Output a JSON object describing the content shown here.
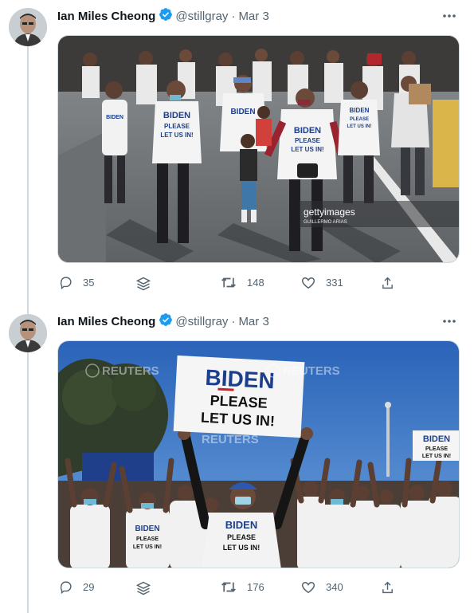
{
  "tweets": [
    {
      "name": "Ian Miles Cheong",
      "handle": "@stillgray",
      "separator": "·",
      "date": "Mar 3",
      "image_caption_credit": {
        "brand": "gettyimages",
        "photographer": "GUILLERMO ARIAS"
      },
      "image_sign_text": [
        "BIDEN",
        "PLEASE",
        "LET US IN!"
      ],
      "replies": "35",
      "retweets": "148",
      "likes": "331"
    },
    {
      "name": "Ian Miles Cheong",
      "handle": "@stillgray",
      "separator": "·",
      "date": "Mar 3",
      "watermark": "REUTERS",
      "image_sign_text": [
        "BIDEN",
        "PLEASE",
        "LET US IN!"
      ],
      "replies": "29",
      "retweets": "176",
      "likes": "340"
    }
  ],
  "icons": {
    "verified": "verified-badge-icon",
    "more": "more-options-icon",
    "reply": "reply-icon",
    "bookmark": "stack-icon",
    "retweet": "retweet-icon",
    "like": "heart-icon",
    "share": "share-icon"
  },
  "colors": {
    "verified": "#1d9bf0",
    "icon_gray": "#536471",
    "line": "#cfd9de"
  }
}
